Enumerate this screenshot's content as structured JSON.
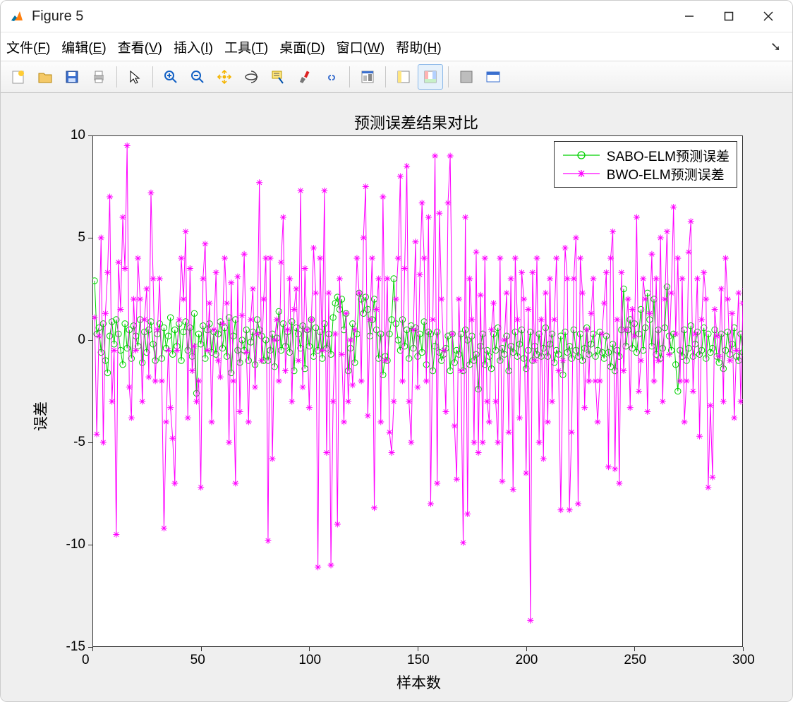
{
  "window": {
    "title": "Figure 5"
  },
  "menu": {
    "file": {
      "label": "文件",
      "key": "F"
    },
    "edit": {
      "label": "编辑",
      "key": "E"
    },
    "view": {
      "label": "查看",
      "key": "V"
    },
    "insert": {
      "label": "插入",
      "key": "I"
    },
    "tools": {
      "label": "工具",
      "key": "T"
    },
    "desktop": {
      "label": "桌面",
      "key": "D"
    },
    "window": {
      "label": "窗口",
      "key": "W"
    },
    "help": {
      "label": "帮助",
      "key": "H"
    }
  },
  "toolbar_icons": [
    "new-figure-icon",
    "open-icon",
    "save-icon",
    "print-icon",
    "sep",
    "pointer-icon",
    "sep",
    "zoom-in-icon",
    "zoom-out-icon",
    "pan-icon",
    "rotate3d-icon",
    "data-cursor-icon",
    "brush-icon",
    "link-icon",
    "sep",
    "insert-colorbar-icon",
    "sep",
    "hide-plot-tools-icon",
    "show-plot-tools-icon",
    "sep",
    "annotation-icon",
    "property-editor-icon"
  ],
  "chart_data": {
    "type": "line",
    "title": "预测误差结果对比",
    "xlabel": "样本数",
    "ylabel": "误差",
    "xlim": [
      0,
      300
    ],
    "ylim": [
      -15,
      10
    ],
    "xticks": [
      0,
      50,
      100,
      150,
      200,
      250,
      300
    ],
    "yticks": [
      -15,
      -10,
      -5,
      0,
      5,
      10
    ],
    "legend": {
      "position": "northeast",
      "entries": [
        {
          "name": "SABO-ELM预测误差",
          "color": "#00d000",
          "marker": "o"
        },
        {
          "name": "BWO-ELM预测误差",
          "color": "#ff00ff",
          "marker": "*"
        }
      ]
    },
    "series": [
      {
        "name": "SABO-ELM预测误差",
        "color": "#00d000",
        "marker": "o",
        "x_start": 1,
        "values": [
          2.9,
          0.3,
          0.6,
          -0.6,
          0.8,
          -1.0,
          -1.6,
          0.2,
          0.9,
          -0.2,
          1.0,
          0.3,
          -0.5,
          -1.2,
          0.8,
          -0.4,
          0.5,
          -0.9,
          0.7,
          0.2,
          -0.3,
          1.0,
          -1.1,
          0.4,
          -0.6,
          0.5,
          0.9,
          -0.2,
          -1.0,
          0.3,
          0.8,
          -0.9,
          0.6,
          -0.4,
          0.2,
          1.1,
          -0.7,
          0.5,
          -0.3,
          0.8,
          -1.0,
          0.4,
          0.9,
          -0.5,
          0.6,
          -0.8,
          1.3,
          -2.6,
          0.3,
          -0.2,
          0.7,
          -0.9,
          0.5,
          0.8,
          -0.6,
          0.4,
          -0.7,
          0.3,
          0.9,
          -0.4,
          0.6,
          -0.8,
          1.1,
          -1.6,
          0.2,
          1.0,
          -0.5,
          -1.1,
          0.0,
          -0.5,
          0.5,
          -1.0,
          -0.1,
          0.4,
          -1.2,
          1.0,
          0.5,
          0.2,
          -1.0,
          0.0,
          -1.0,
          -0.5,
          0.3,
          -1.3,
          0.1,
          1.4,
          -0.5,
          0.8,
          -0.3,
          0.4,
          -0.6,
          0.9,
          -1.5,
          0.6,
          0.3,
          -0.4,
          0.7,
          -1.4,
          0.5,
          -0.3,
          1.0,
          -0.8,
          0.6,
          -0.5,
          0.4,
          -0.9,
          0.8,
          -0.4,
          0.3,
          -0.7,
          1.1,
          1.8,
          2.1,
          1.5,
          2.0,
          0.5,
          1.3,
          -1.5,
          -0.4,
          0.8,
          -1.1,
          0.3,
          2.3,
          2.0,
          1.3,
          2.1,
          1.5,
          0.2,
          1.0,
          2.0,
          0.5,
          -0.9,
          0.3,
          -1.7,
          -0.8,
          -1.0,
          0.3,
          1.0,
          3.0,
          0.8,
          0.0,
          -0.5,
          1.0,
          -0.3,
          0.5,
          -0.9,
          0.7,
          -0.4,
          0.6,
          -0.8,
          0.3,
          -0.6,
          0.9,
          -1.2,
          0.4,
          0.3,
          -1.5,
          -0.3,
          0.4,
          -0.6,
          -1.0,
          -0.7,
          -0.4,
          0.2,
          -1.5,
          0.3,
          -1.1,
          -0.5,
          -0.7,
          0.3,
          -1.5,
          0.5,
          0.0,
          -1.2,
          0.2,
          -1.0,
          -0.7,
          -2.4,
          -0.3,
          0.3,
          -1.2,
          -0.5,
          -0.8,
          -1.4,
          0.3,
          -0.5,
          0.6,
          -1.0,
          -0.4,
          -0.7,
          0.2,
          -1.5,
          -0.3,
          -0.6,
          0.4,
          -0.8,
          -0.2,
          0.5,
          -0.9,
          -1.4,
          -0.5,
          0.4,
          -1.0,
          -0.3,
          -0.7,
          0.3,
          -0.8,
          -0.4,
          0.6,
          -0.8,
          -0.2,
          0.3,
          -1.1,
          -0.5,
          -0.7,
          0.2,
          -1.7,
          0.4,
          -0.6,
          -0.3,
          -0.9,
          0.5,
          -0.5,
          -0.8,
          0.3,
          -1.0,
          -0.4,
          0.6,
          -0.7,
          -0.2,
          0.3,
          -0.8,
          -0.5,
          0.4,
          -0.6,
          -0.9,
          0.2,
          -0.6,
          -1.3,
          -0.2,
          -1.5,
          -0.5,
          -0.8,
          0.5,
          2.5,
          -0.3,
          0.5,
          1.0,
          -0.4,
          0.8,
          -0.6,
          0.3,
          1.5,
          -0.5,
          0.6,
          2.3,
          1.0,
          -0.3,
          2.0,
          -0.7,
          0.5,
          -0.9,
          -0.4,
          0.6,
          2.6,
          0.2,
          -0.5,
          0.3,
          -1.2,
          -2.5,
          -0.5,
          -0.8,
          0.5,
          -1.0,
          -0.4,
          0.7,
          -0.8,
          -0.2,
          0.4,
          -0.7,
          -0.5,
          0.6,
          -0.9,
          0.3,
          -0.6,
          -0.4,
          0.5,
          -0.8,
          -1.1,
          0.3,
          -1.4,
          -0.5,
          0.4,
          -0.7,
          -0.2,
          0.6,
          -0.8,
          -1.0,
          0.3,
          -0.6,
          -0.4
        ]
      },
      {
        "name": "BWO-ELM预测误差",
        "color": "#ff00ff",
        "marker": "*",
        "x_start": 1,
        "values": [
          1.1,
          -4.6,
          0.2,
          5.0,
          -5.0,
          1.3,
          3.3,
          7.0,
          -3.0,
          -0.5,
          -9.5,
          3.8,
          1.5,
          6.0,
          3.5,
          9.5,
          -2.3,
          -3.8,
          2.0,
          -0.5,
          4.0,
          2.0,
          -3.0,
          1.0,
          2.5,
          -1.8,
          7.2,
          3.0,
          -2.0,
          0.5,
          3.0,
          -2.0,
          -9.2,
          -4.0,
          -0.5,
          -3.3,
          -4.8,
          -7.0,
          -0.5,
          1.0,
          4.0,
          2.0,
          5.3,
          -3.8,
          3.5,
          -1.5,
          -0.3,
          -3.0,
          -2.0,
          -7.2,
          3.0,
          4.7,
          -0.5,
          1.8,
          -4.0,
          0.5,
          3.3,
          -1.0,
          -1.8,
          0.8,
          4.0,
          1.8,
          -5.0,
          2.8,
          -2.0,
          -7.0,
          3.1,
          -3.5,
          1.2,
          4.2,
          -0.6,
          -4.0,
          1.0,
          2.5,
          -2.3,
          0.3,
          7.7,
          -1.0,
          2.0,
          4.0,
          -9.8,
          4.0,
          -5.8,
          0.0,
          1.0,
          -2.0,
          3.8,
          6.0,
          -1.5,
          0.5,
          3.0,
          -3.0,
          1.5,
          2.5,
          -1.0,
          7.3,
          -2.3,
          3.5,
          0.5,
          -3.3,
          1.0,
          4.5,
          2.3,
          -11.1,
          4.0,
          -0.5,
          7.3,
          -5.5,
          2.3,
          -11.0,
          -3.0,
          0.3,
          -9.0,
          3.0,
          -0.7,
          -4.0,
          1.3,
          -3.0,
          0.0,
          -2.2,
          0.5,
          4.0,
          2.3,
          -2.0,
          5.0,
          7.5,
          -3.7,
          1.0,
          4.0,
          -8.2,
          1.5,
          3.0,
          -4.0,
          7.0,
          -1.0,
          3.0,
          -4.5,
          -5.5,
          -3.0,
          2.0,
          4.0,
          8.0,
          -2.0,
          3.5,
          8.5,
          -3.0,
          -5.0,
          0.5,
          4.8,
          -2.3,
          3.2,
          6.7,
          4.0,
          -2.0,
          6.0,
          -8.0,
          1.0,
          9.0,
          -7.0,
          6.2,
          2.0,
          -0.5,
          -3.5,
          6.7,
          9.0,
          0.3,
          -4.2,
          -6.8,
          2.0,
          -1.5,
          -9.9,
          6.0,
          -8.5,
          3.0,
          1.0,
          -5.0,
          4.3,
          -5.5,
          2.2,
          -5.0,
          4.0,
          -3.0,
          -4.0,
          0.5,
          1.8,
          -3.0,
          -5.0,
          4.0,
          -6.9,
          0.0,
          2.3,
          -4.5,
          3.0,
          -7.3,
          4.0,
          1.0,
          -3.8,
          3.3,
          2.0,
          -6.5,
          1.5,
          -13.7,
          3.3,
          -1.0,
          4.0,
          -5.0,
          1.0,
          -5.8,
          2.3,
          -4.0,
          3.0,
          -3.0,
          1.0,
          4.0,
          -1.5,
          -8.3,
          -1.0,
          4.5,
          3.0,
          -8.3,
          -4.5,
          3.0,
          5.0,
          -8.0,
          4.0,
          2.3,
          -3.3,
          0.5,
          -2.0,
          1.3,
          3.0,
          -2.0,
          -4.0,
          -2.0,
          0.3,
          1.8,
          3.3,
          -6.2,
          4.0,
          5.3,
          -6.3,
          1.0,
          -7.0,
          3.3,
          -1.5,
          0.5,
          2.0,
          -3.3,
          1.5,
          0.2,
          6.0,
          -2.5,
          -1.0,
          3.0,
          2.0,
          -3.5,
          1.3,
          4.2,
          -2.0,
          3.0,
          -1.0,
          5.0,
          -3.0,
          2.0,
          5.3,
          -0.7,
          2.3,
          6.5,
          0.3,
          4.0,
          -2.0,
          3.0,
          -4.0,
          -2.0,
          4.3,
          5.8,
          -2.5,
          0.3,
          3.0,
          -4.7,
          1.0,
          3.3,
          2.0,
          -7.2,
          -3.2,
          -6.7,
          1.5,
          0.2,
          -0.8,
          2.5,
          -3.0,
          4.0,
          2.0,
          -1.0,
          1.3,
          -3.8,
          -0.5,
          2.3,
          -3.0,
          1.8,
          2.5,
          -1.0
        ]
      }
    ]
  },
  "colors": {
    "grid_bg": "#efefef",
    "axis": "#333333"
  }
}
